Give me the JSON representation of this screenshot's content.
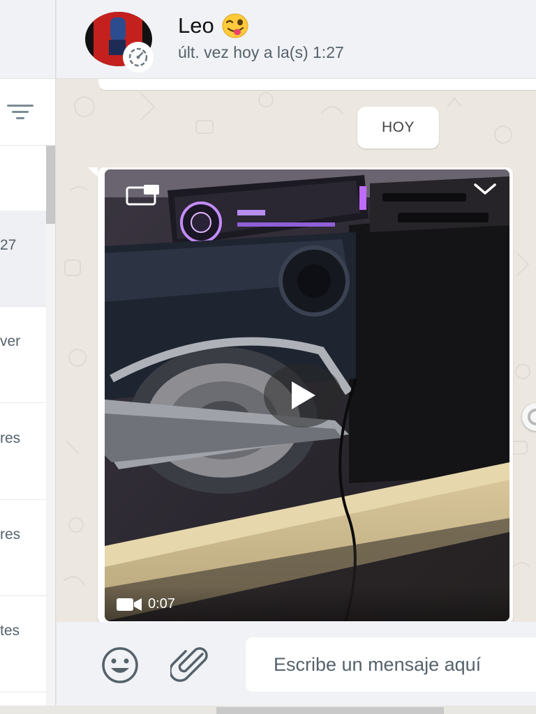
{
  "header": {
    "contact_name": "Leo",
    "last_seen": "últ. vez hoy a la(s) 1:27",
    "name_emoji": "winking-face-with-tongue"
  },
  "sidebar": {
    "rows": [
      {
        "fragment": ""
      },
      {
        "fragment": "27",
        "active": true
      },
      {
        "fragment": "ver"
      },
      {
        "fragment": "res"
      },
      {
        "fragment": "res"
      },
      {
        "fragment": "tes"
      }
    ]
  },
  "chat": {
    "date_label": "HOY",
    "message": {
      "type": "video",
      "duration": "0:07"
    }
  },
  "composer": {
    "placeholder": "Escribe un mensaje aquí"
  },
  "icons": {
    "filter": "filter-icon",
    "status": "status-icon",
    "pip": "picture-in-picture-icon",
    "dropdown": "chevron-down-icon",
    "play": "play-icon",
    "video_camera": "video-camera-icon",
    "emoji": "emoji-icon",
    "attach": "paperclip-icon"
  },
  "colors": {
    "header_bg": "#f0f2f5",
    "chat_bg": "#ece8e1",
    "bubble_bg": "#ffffff",
    "icon_gray": "#7b8a93"
  }
}
